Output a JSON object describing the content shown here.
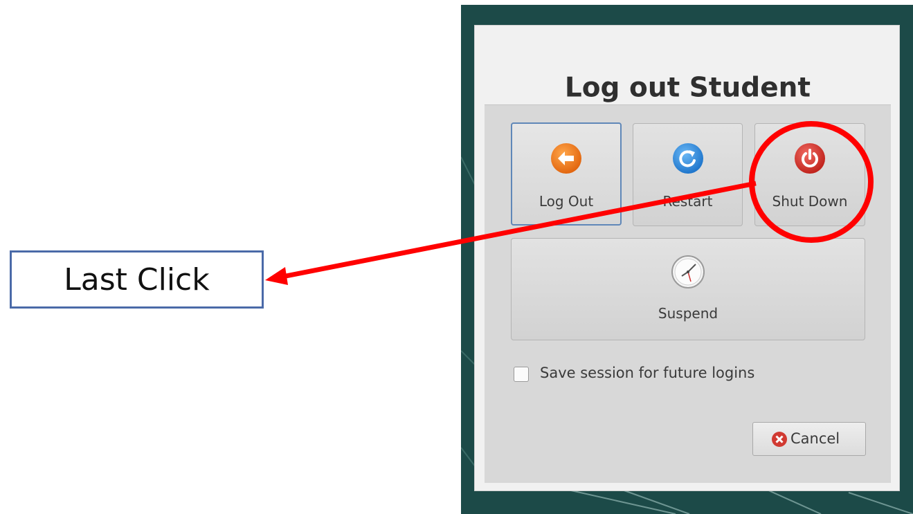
{
  "dialog": {
    "title": "Log out Student",
    "actions": [
      {
        "label": "Log Out",
        "icon": "arrow-left-icon",
        "color": "#f07f1f"
      },
      {
        "label": "Restart",
        "icon": "refresh-icon",
        "color": "#2e8de0"
      },
      {
        "label": "Shut Down",
        "icon": "power-icon",
        "color": "#d9302a"
      }
    ],
    "suspend_label": "Suspend",
    "save_session_label": "Save session for future logins",
    "save_session_checked": false,
    "cancel_label": "Cancel"
  },
  "annotation": {
    "callout_text": "Last Click",
    "highlight_color": "#ff0000",
    "box_border_color": "#4a6aa8"
  },
  "colors": {
    "desktop_bg": "#1c4a48",
    "dialog_bg": "#f1f1f1",
    "focus_border": "#5f87b8"
  }
}
